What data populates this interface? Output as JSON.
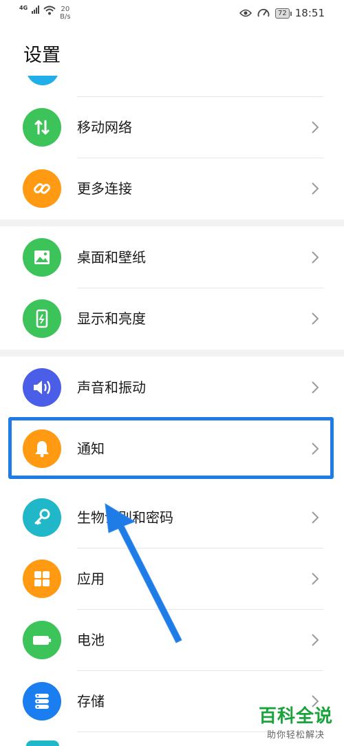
{
  "status": {
    "network_type": "4G",
    "speed_value": "20",
    "speed_unit": "B/s",
    "battery_level": "72",
    "time": "18:51"
  },
  "page_title": "设置",
  "settings_items": [
    {
      "label": "移动网络",
      "icon": "mobile-data-icon",
      "color": "#3cc35a"
    },
    {
      "label": "更多连接",
      "icon": "link-icon",
      "color": "#ff9a12"
    },
    {
      "label": "桌面和壁纸",
      "icon": "image-icon",
      "color": "#3cc35a"
    },
    {
      "label": "显示和亮度",
      "icon": "phone-brightness-icon",
      "color": "#3cc35a"
    },
    {
      "label": "声音和振动",
      "icon": "speaker-icon",
      "color": "#4a5ee8"
    },
    {
      "label": "通知",
      "icon": "bell-icon",
      "color": "#ff9a12"
    },
    {
      "label": "生物识别和密码",
      "icon": "key-icon",
      "color": "#20b8c8"
    },
    {
      "label": "应用",
      "icon": "apps-grid-icon",
      "color": "#ff9a12"
    },
    {
      "label": "电池",
      "icon": "battery-icon",
      "color": "#3cc35a"
    },
    {
      "label": "存储",
      "icon": "storage-icon",
      "color": "#1a7ef0"
    }
  ],
  "highlighted_item": "通知",
  "watermark": {
    "main": "百科全说",
    "sub": "助你轻松解决"
  }
}
